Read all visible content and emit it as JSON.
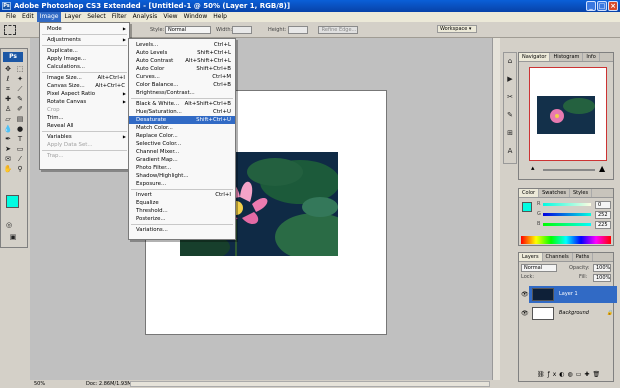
{
  "app": {
    "title": "Adobe Photoshop CS3 Extended - [Untitled-1 @ 50% (Layer 1, RGB/8)]"
  },
  "menubar": [
    "File",
    "Edit",
    "Image",
    "Layer",
    "Select",
    "Filter",
    "Analysis",
    "View",
    "Window",
    "Help"
  ],
  "options": {
    "style_label": "Style:",
    "style_value": "Normal",
    "width_label": "Width:",
    "height_label": "Height:",
    "refine_label": "Refine Edge...",
    "workspace_label": "Workspace ▾"
  },
  "image_menu": [
    {
      "label": "Mode",
      "sub": true
    },
    {
      "sep": true
    },
    {
      "label": "Adjustments",
      "sub": true
    },
    {
      "sep": true
    },
    {
      "label": "Duplicate..."
    },
    {
      "label": "Apply Image..."
    },
    {
      "label": "Calculations..."
    },
    {
      "sep": true
    },
    {
      "label": "Image Size...",
      "sc": "Alt+Ctrl+I"
    },
    {
      "label": "Canvas Size...",
      "sc": "Alt+Ctrl+C"
    },
    {
      "label": "Pixel Aspect Ratio",
      "sub": true
    },
    {
      "label": "Rotate Canvas",
      "sub": true
    },
    {
      "label": "Crop",
      "dis": true
    },
    {
      "label": "Trim..."
    },
    {
      "label": "Reveal All"
    },
    {
      "sep": true
    },
    {
      "label": "Variables",
      "sub": true
    },
    {
      "label": "Apply Data Set...",
      "dis": true
    },
    {
      "sep": true
    },
    {
      "label": "Trap...",
      "dis": true
    }
  ],
  "adj_menu": [
    {
      "label": "Levels...",
      "sc": "Ctrl+L"
    },
    {
      "label": "Auto Levels",
      "sc": "Shift+Ctrl+L"
    },
    {
      "label": "Auto Contrast",
      "sc": "Alt+Shift+Ctrl+L"
    },
    {
      "label": "Auto Color",
      "sc": "Shift+Ctrl+B"
    },
    {
      "label": "Curves...",
      "sc": "Ctrl+M"
    },
    {
      "label": "Color Balance...",
      "sc": "Ctrl+B"
    },
    {
      "label": "Brightness/Contrast..."
    },
    {
      "sep": true
    },
    {
      "label": "Black & White...",
      "sc": "Alt+Shift+Ctrl+B"
    },
    {
      "label": "Hue/Saturation...",
      "sc": "Ctrl+U"
    },
    {
      "label": "Desaturate",
      "sc": "Shift+Ctrl+U",
      "hl": true
    },
    {
      "label": "Match Color..."
    },
    {
      "label": "Replace Color..."
    },
    {
      "label": "Selective Color..."
    },
    {
      "label": "Channel Mixer..."
    },
    {
      "label": "Gradient Map..."
    },
    {
      "label": "Photo Filter..."
    },
    {
      "label": "Shadow/Highlight..."
    },
    {
      "label": "Exposure..."
    },
    {
      "sep": true
    },
    {
      "label": "Invert",
      "sc": "Ctrl+I"
    },
    {
      "label": "Equalize"
    },
    {
      "label": "Threshold..."
    },
    {
      "label": "Posterize..."
    },
    {
      "sep": true
    },
    {
      "label": "Variations..."
    }
  ],
  "navigator": {
    "tabs": [
      "Navigator",
      "Histogram",
      "Info"
    ]
  },
  "color_panel": {
    "tabs": [
      "Color",
      "Swatches",
      "Styles"
    ],
    "r": "0",
    "g": "252",
    "b": "225",
    "fg": "#00fce1"
  },
  "layers": {
    "tabs": [
      "Layers",
      "Channels",
      "Paths"
    ],
    "blend": "Normal",
    "opacity_label": "Opacity:",
    "opacity": "100%",
    "lock_label": "Lock:",
    "fill_label": "Fill:",
    "fill": "100%",
    "items": [
      {
        "name": "Layer 1",
        "selected": true
      },
      {
        "name": "Background",
        "selected": false
      }
    ]
  },
  "status": {
    "zoom": "50%",
    "doc": "Doc: 2.86M/1.93M"
  }
}
